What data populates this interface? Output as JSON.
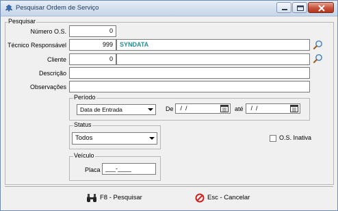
{
  "window": {
    "title": "Pesquisar Ordem de Serviço"
  },
  "pesquisar": {
    "legend": "Pesquisar",
    "numero_os": {
      "label": "Número O.S.",
      "value": "0"
    },
    "tecnico": {
      "label": "Técnico Responsável",
      "code": "999",
      "name": "SYNDATA"
    },
    "cliente": {
      "label": "Cliente",
      "code": "0",
      "name": ""
    },
    "descricao": {
      "label": "Descrição",
      "value": ""
    },
    "observacoes": {
      "label": "Observações",
      "value": ""
    },
    "periodo": {
      "legend": "Período",
      "tipo": "Data de Entrada",
      "de_label": "De",
      "de_value": " /  /",
      "ate_label": "até",
      "ate_value": " /  /"
    },
    "status": {
      "legend": "Status",
      "value": "Todos"
    },
    "os_inativa": {
      "label": "O.S. Inativa",
      "checked": false
    },
    "veiculo": {
      "legend": "Veículo",
      "placa_label": "Placa",
      "placa_value": "___-____"
    }
  },
  "footer": {
    "pesquisar_label": "F8 - Pesquisar",
    "cancelar_label": "Esc - Cancelar"
  },
  "colors": {
    "accent_teal": "#2a8c8c",
    "cancel_red": "#d02020"
  }
}
